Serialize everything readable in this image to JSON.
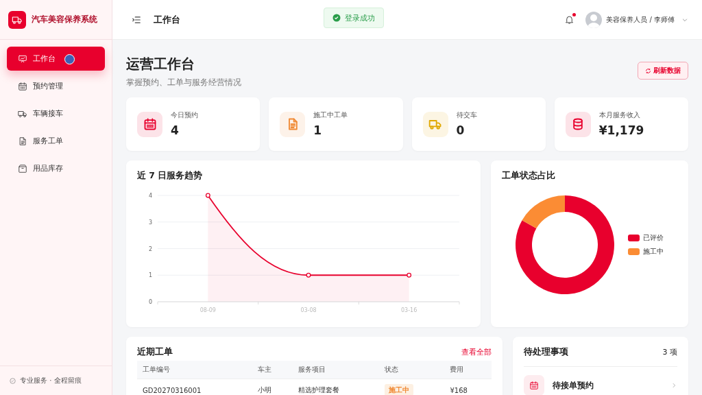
{
  "sidebar": {
    "brand": "汽车美容保养系统",
    "items": [
      {
        "label": "工作台",
        "selected": true
      },
      {
        "label": "预约管理",
        "selected": false
      },
      {
        "label": "车辆接车",
        "selected": false
      },
      {
        "label": "服务工单",
        "selected": false
      },
      {
        "label": "用品库存",
        "selected": false
      }
    ],
    "footer": "专业服务 · 全程留痕"
  },
  "header": {
    "title": "工作台",
    "toast": "登录成功",
    "notification": true,
    "user": "美容保养人员 / 李师傅"
  },
  "page": {
    "title": "运营工作台",
    "subtitle": "掌握预约、工单与服务经营情况",
    "refresh": "刷新数据"
  },
  "stats": [
    {
      "label": "今日预约",
      "value": "4",
      "color": "#e8002d"
    },
    {
      "label": "施工中工单",
      "value": "1",
      "color": "#f08a35"
    },
    {
      "label": "待交车",
      "value": "0",
      "color": "#e0a800"
    },
    {
      "label": "本月服务收入",
      "value": "¥1,179",
      "color": "#e8002d"
    }
  ],
  "trend": {
    "title": "近 7 日服务趋势",
    "chart_data": {
      "type": "area",
      "categories": [
        "08-09",
        "03-08",
        "03-16"
      ],
      "series": [
        {
          "color": "#e8002d",
          "values": [
            4,
            1,
            1
          ]
        }
      ],
      "ylim": [
        0,
        4
      ],
      "yticks": [
        0,
        1,
        2,
        3,
        4
      ],
      "grid": true
    }
  },
  "status": {
    "title": "工单状态占比",
    "chart_data": {
      "type": "donut",
      "categories": [
        "已评价",
        "施工中"
      ],
      "series": [
        {
          "values": [
            83.3,
            16.7
          ]
        }
      ],
      "colors": [
        "#e8002d",
        "#fb8c34"
      ]
    }
  },
  "orders": {
    "title": "近期工单",
    "link": "查看全部",
    "columns": [
      "工单编号",
      "车主",
      "服务项目",
      "状态",
      "费用"
    ],
    "rows": [
      {
        "cells": [
          "GD20270316001",
          "小明",
          "精选护理套餐"
        ],
        "status": "施工中",
        "fee": "¥168"
      }
    ]
  },
  "pending": {
    "title": "待处理事项",
    "count": "3 项",
    "items": [
      {
        "label": "待接单预约"
      }
    ]
  }
}
